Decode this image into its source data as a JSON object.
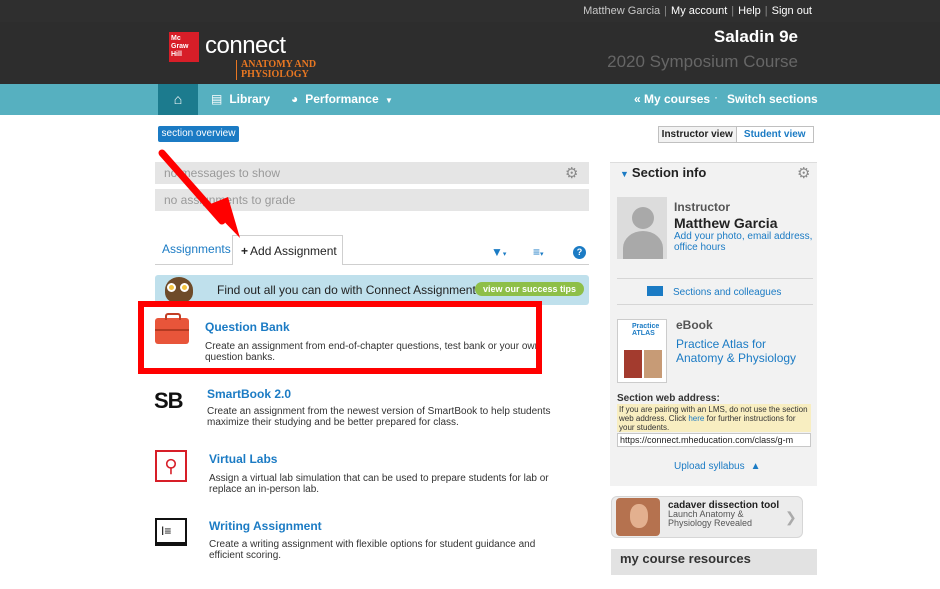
{
  "util": {
    "user": "Matthew Garcia",
    "my_account": "My account",
    "help": "Help",
    "sign_out": "Sign out"
  },
  "header": {
    "mh_logo": "Mc Graw Hill",
    "connect": "connect",
    "product_line1": "ANATOMY AND",
    "product_line2": "PHYSIOLOGY",
    "course_title": "Saladin 9e",
    "course_subtitle": "2020 Symposium Course"
  },
  "nav": {
    "home_icon": "home-icon",
    "library": "Library",
    "performance": "Performance",
    "my_courses": "« My courses",
    "switch_sections": "Switch sections"
  },
  "main": {
    "section_overview": "section overview",
    "instructor_view": "Instructor view",
    "student_view": "Student view",
    "messages": "no messages to show",
    "grading": "no assignments to grade",
    "tab_assignments": "Assignments",
    "tab_add": "Add Assignment",
    "banner_text": "Find out all you can do with Connect Assignments.",
    "banner_button": "view our success tips",
    "options": [
      {
        "title": "Question Bank",
        "desc": "Create an assignment from end-of-chapter questions, test bank or your own question banks."
      },
      {
        "title": "SmartBook 2.0",
        "desc": "Create an assignment from the newest version of SmartBook to help students maximize their studying and be better prepared for class."
      },
      {
        "title": "Virtual Labs",
        "desc": "Assign a virtual lab simulation that can be used to prepare students for lab or replace an in-person lab."
      },
      {
        "title": "Writing Assignment",
        "desc": "Create a writing assignment with flexible options for student guidance and efficient scoring."
      }
    ],
    "smartbook_icon_text": "SB"
  },
  "side": {
    "heading": "Section info",
    "instructor_label": "Instructor",
    "instructor_name": "Matthew Garcia",
    "instructor_link": "Add your photo, email address, office hours",
    "sections_colleagues": "Sections and colleagues",
    "ebook_label": "eBook",
    "ebook_link": "Practice Atlas for Anatomy & Physiology",
    "ebook_thumb_text": "Practice ATLAS",
    "web_address_label": "Section web address:",
    "web_address_note_pre": "If you are pairing with an LMS, do not use the section web address. Click ",
    "web_address_note_link": "here",
    "web_address_note_post": " for further instructions for your students.",
    "web_address_value": "https://connect.mheducation.com/class/g-m",
    "upload": "Upload syllabus"
  },
  "cadaver": {
    "title": "cadaver dissection tool",
    "subtitle": "Launch Anatomy & Physiology Revealed"
  },
  "resources": {
    "title": "my course resources"
  },
  "colors": {
    "nav_teal": "#56b0c0",
    "link_blue": "#1b7bc4",
    "highlight_red": "#ff0000",
    "product_orange": "#e87722"
  }
}
